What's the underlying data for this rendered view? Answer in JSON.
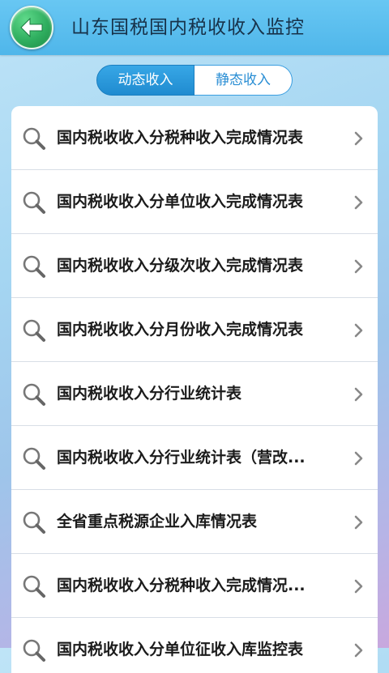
{
  "header": {
    "title": "山东国税国内税收收入监控",
    "back_icon": "back-arrow-icon"
  },
  "tabs": [
    {
      "label": "动态收入",
      "active": true
    },
    {
      "label": "静态收入",
      "active": false
    }
  ],
  "list": {
    "items": [
      {
        "label": "国内税收收入分税种收入完成情况表"
      },
      {
        "label": "国内税收收入分单位收入完成情况表"
      },
      {
        "label": "国内税收收入分级次收入完成情况表"
      },
      {
        "label": "国内税收收入分月份收入完成情况表"
      },
      {
        "label": "国内税收收入分行业统计表"
      },
      {
        "label": "国内税收收入分行业统计表（营改..."
      },
      {
        "label": "全省重点税源企业入库情况表"
      },
      {
        "label": "国内税收收入分税种收入完成情况..."
      },
      {
        "label": "国内税收收入分单位征收入库监控表"
      }
    ]
  },
  "colors": {
    "header": "#4fb6ea",
    "tab_active": "#2a97dc",
    "back_button": "#2fae5f"
  }
}
